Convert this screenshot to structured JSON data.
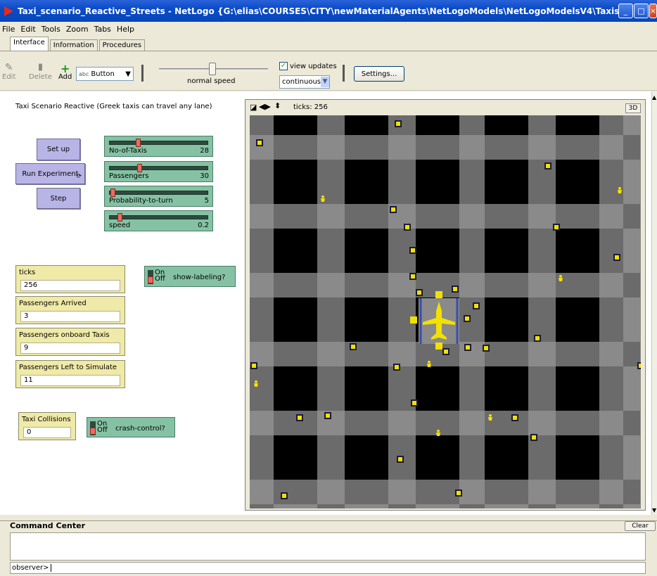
{
  "window": {
    "title": "Taxi_scenario_Reactive_Streets - NetLogo {G:\\elias\\COURSES\\CITY\\newMaterialAgents\\NetLogoModels\\NetLogoModelsV4\\Taxis}"
  },
  "menu": [
    "File",
    "Edit",
    "Tools",
    "Zoom",
    "Tabs",
    "Help"
  ],
  "tabs": [
    "Interface",
    "Information",
    "Procedures"
  ],
  "toolbar": {
    "edit": "Edit",
    "delete": "Delete",
    "add": "Add",
    "widget_type": "Button",
    "speed_label": "normal speed",
    "view_updates": "view updates",
    "update_mode": "continuous",
    "settings": "Settings..."
  },
  "info_text": "Taxi Scenario Reactive (Greek taxis can travel any lane)",
  "buttons": {
    "setup": "Set up",
    "run": "Run Experiment",
    "step": "Step"
  },
  "sliders": [
    {
      "name": "No-of-Taxis",
      "value": "28",
      "fraction": 0.27
    },
    {
      "name": "Passengers",
      "value": "30",
      "fraction": 0.29
    },
    {
      "name": "Probability-to-turn",
      "value": "5",
      "fraction": 0.03
    },
    {
      "name": "speed",
      "value": "0.2",
      "fraction": 0.1
    }
  ],
  "monitors": {
    "ticks": {
      "label": "ticks",
      "value": "256"
    },
    "arrived": {
      "label": "Passengers Arrived",
      "value": "3"
    },
    "onboard": {
      "label": "Passengers onboard Taxis",
      "value": "9"
    },
    "left": {
      "label": "Passengers Left to Simulate",
      "value": "11"
    },
    "collisions": {
      "label": "Taxi Collisions",
      "value": "0"
    }
  },
  "switches": {
    "labeling": {
      "on": "On",
      "off": "Off",
      "name": "show-labeling?"
    },
    "crash": {
      "on": "On",
      "off": "Off",
      "name": "crash-control?"
    }
  },
  "view": {
    "ticks_label": "ticks: 256",
    "threed": "3D"
  },
  "command_center": {
    "title": "Command Center",
    "clear": "Clear",
    "prompt": "observer>"
  },
  "colors": {
    "block": "#000000",
    "road_light": "#8a8a8a",
    "road_dark": "#6b6b6b",
    "taxi": "#f2e000",
    "passenger": "#f2e000",
    "airport": "#3b4fa8"
  }
}
